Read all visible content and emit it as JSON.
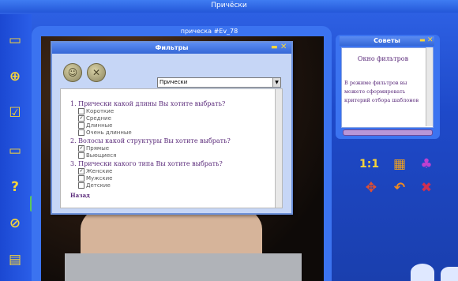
{
  "app": {
    "window_title": "Причёски"
  },
  "photo_window": {
    "title": "прическа #Ev_78"
  },
  "left_toolbar": {
    "icons": [
      "folder-icon",
      "globe-icon",
      "checklist-icon",
      "chat-icon",
      "help-icon",
      "forbidden-icon",
      "notes-icon"
    ]
  },
  "filters_dialog": {
    "title": "Фильтры",
    "min_glyph": "▬",
    "close_glyph": "✕",
    "apply_glyph": "☺",
    "cancel_glyph": "✕",
    "select_value": "Прически",
    "select_arrow": "▼",
    "questions": [
      {
        "text": "1. Прически какой длины Вы хотите выбрать?",
        "options": [
          {
            "label": "Короткие",
            "checked": false
          },
          {
            "label": "Средние",
            "checked": true
          },
          {
            "label": "Длинные",
            "checked": false
          },
          {
            "label": "Очень длинные",
            "checked": false
          }
        ]
      },
      {
        "text": "2. Волосы какой структуры Вы хотите выбрать?",
        "options": [
          {
            "label": "Прямые",
            "checked": true
          },
          {
            "label": "Вьющиеся",
            "checked": false
          }
        ]
      },
      {
        "text": "3. Прически какого типа Вы хотите выбрать?",
        "options": [
          {
            "label": "Женские",
            "checked": true
          },
          {
            "label": "Мужские",
            "checked": false
          },
          {
            "label": "Детские",
            "checked": false
          }
        ]
      }
    ],
    "back_label": "Назад"
  },
  "tips_panel": {
    "title": "Советы",
    "heading": "Окно фильтров",
    "body": "В режиме фильтров вы можете сформировать критерий отбора шаблонов"
  },
  "right_tools": {
    "ratio_label": "1:1"
  }
}
